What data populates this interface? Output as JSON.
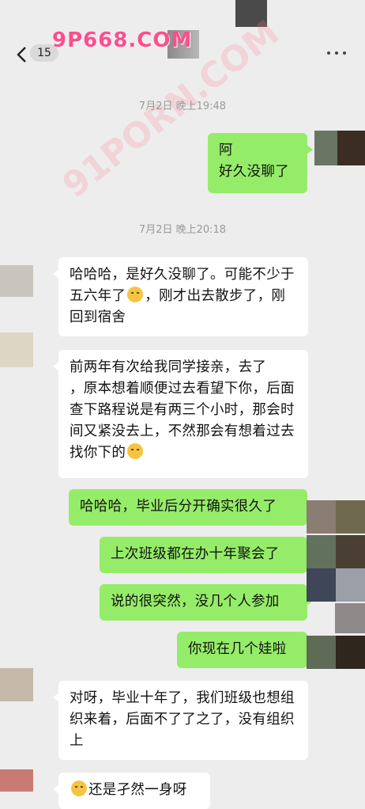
{
  "header": {
    "back_count": "15",
    "watermark_top": "9P668.COM",
    "watermark_diag": "91PORN.COM"
  },
  "messages": [
    {
      "type": "time",
      "text": "7月2日 晚上19:48"
    },
    {
      "type": "me",
      "text": "阿\n好久没聊了"
    },
    {
      "type": "time",
      "text": "7月2日 晚上20:18"
    },
    {
      "type": "other",
      "text_a": "哈哈哈，是好久没聊了。可能不少于五六年了",
      "text_b": "，刚才出去散步了，刚回到宿舍"
    },
    {
      "type": "other",
      "text_a": "前两年有次给我同学接亲，去了\n，原本想着顺便过去看望下你，后面查下路程说是有两三个小时，那会时间又紧没去上，不然那会有想着过去找你下的",
      "text_b": ""
    },
    {
      "type": "me",
      "text": "哈哈哈，毕业后分开确实很久了"
    },
    {
      "type": "me",
      "text": "上次班级都在办十年聚会了"
    },
    {
      "type": "me",
      "text": "说的很突然，没几个人参加"
    },
    {
      "type": "me",
      "text": "你现在几个娃啦"
    },
    {
      "type": "other",
      "text_a": "对呀，毕业十年了，我们班级也想组织来着，后面不了了之了，没有组织上",
      "text_b": ""
    },
    {
      "type": "other",
      "text_a": "还是孑然一身呀",
      "text_b": ""
    }
  ]
}
